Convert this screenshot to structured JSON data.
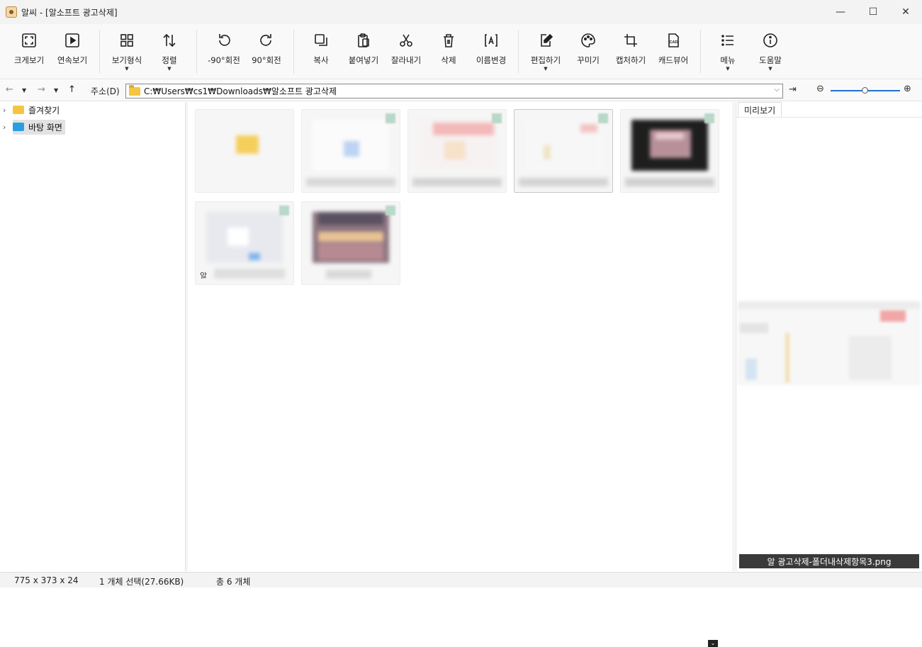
{
  "window": {
    "title": "알씨 - [알소프트 광고삭제]",
    "minimize_glyph": "—",
    "maximize_glyph": "☐",
    "close_glyph": "✕"
  },
  "toolbar": {
    "items": [
      {
        "label": "크게보기",
        "icon": "fullscreen-icon"
      },
      {
        "label": "연속보기",
        "icon": "play-icon"
      },
      {
        "label": "보기형식",
        "icon": "grid-icon"
      },
      {
        "label": "정렬",
        "icon": "sort-icon"
      },
      {
        "label": "-90°회전",
        "icon": "rotate-left-icon"
      },
      {
        "label": "90°회전",
        "icon": "rotate-right-icon"
      },
      {
        "label": "복사",
        "icon": "copy-icon"
      },
      {
        "label": "붙여넣기",
        "icon": "paste-icon"
      },
      {
        "label": "잘라내기",
        "icon": "cut-icon"
      },
      {
        "label": "삭제",
        "icon": "trash-icon"
      },
      {
        "label": "이름변경",
        "icon": "rename-icon"
      },
      {
        "label": "편집하기",
        "icon": "edit-icon"
      },
      {
        "label": "꾸미기",
        "icon": "palette-icon"
      },
      {
        "label": "캡처하기",
        "icon": "crop-icon"
      },
      {
        "label": "캐드뷰어",
        "icon": "cad-icon"
      },
      {
        "label": "메뉴",
        "icon": "list-icon"
      },
      {
        "label": "도움말",
        "icon": "info-icon"
      }
    ]
  },
  "address": {
    "label": "주소(D)",
    "path": "C:₩Users₩cs1₩Downloads₩알소프트 광고삭제"
  },
  "tree": {
    "items": [
      {
        "label": "즐겨찾기"
      },
      {
        "label": "바탕 화면"
      }
    ]
  },
  "grid": {
    "tiles": [
      {
        "name": "",
        "selected": false
      },
      {
        "name": "",
        "selected": false
      },
      {
        "name": "",
        "selected": false
      },
      {
        "name": "",
        "selected": true
      },
      {
        "name": "",
        "selected": false
      },
      {
        "name": "알",
        "selected": false
      },
      {
        "name": "",
        "selected": false
      }
    ]
  },
  "preview": {
    "tab_label": "미리보기",
    "caption": "알  광고삭제-폴더내삭제항목3.png"
  },
  "status": {
    "dimensions": "775 x 373 x 24",
    "selection": "1 개체 선택(27.66KB)",
    "total": "총 6 개체"
  }
}
